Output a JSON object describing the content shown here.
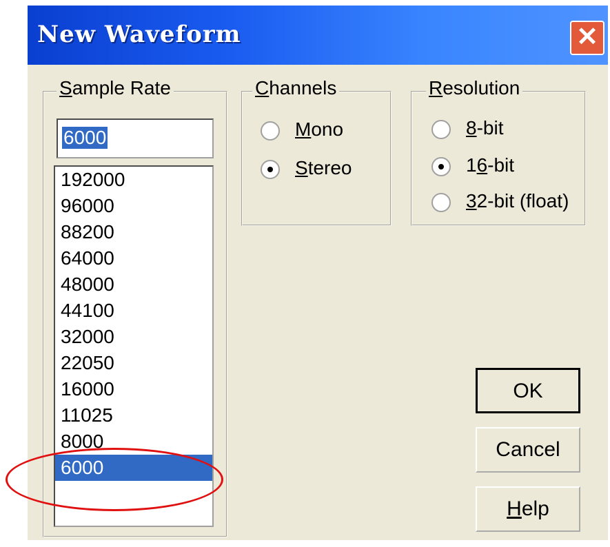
{
  "window": {
    "title": "New Waveform",
    "close_symbol": "✕"
  },
  "sample_rate": {
    "label": "Sample Rate",
    "input_value": "6000",
    "options": [
      "192000",
      "96000",
      "88200",
      "64000",
      "48000",
      "44100",
      "32000",
      "22050",
      "16000",
      "11025",
      "8000",
      "6000"
    ],
    "selected": "6000"
  },
  "channels": {
    "label": "Channels",
    "options": [
      {
        "label": "Mono",
        "checked": false
      },
      {
        "label": "Stereo",
        "checked": true
      }
    ]
  },
  "resolution": {
    "label": "Resolution",
    "options": [
      {
        "label": "8-bit",
        "checked": false
      },
      {
        "label": "16-bit",
        "checked": true
      },
      {
        "label": "32-bit (float)",
        "checked": false
      }
    ]
  },
  "buttons": {
    "ok": "OK",
    "cancel": "Cancel",
    "help": "Help"
  },
  "annotation": {
    "color": "#e01010"
  }
}
